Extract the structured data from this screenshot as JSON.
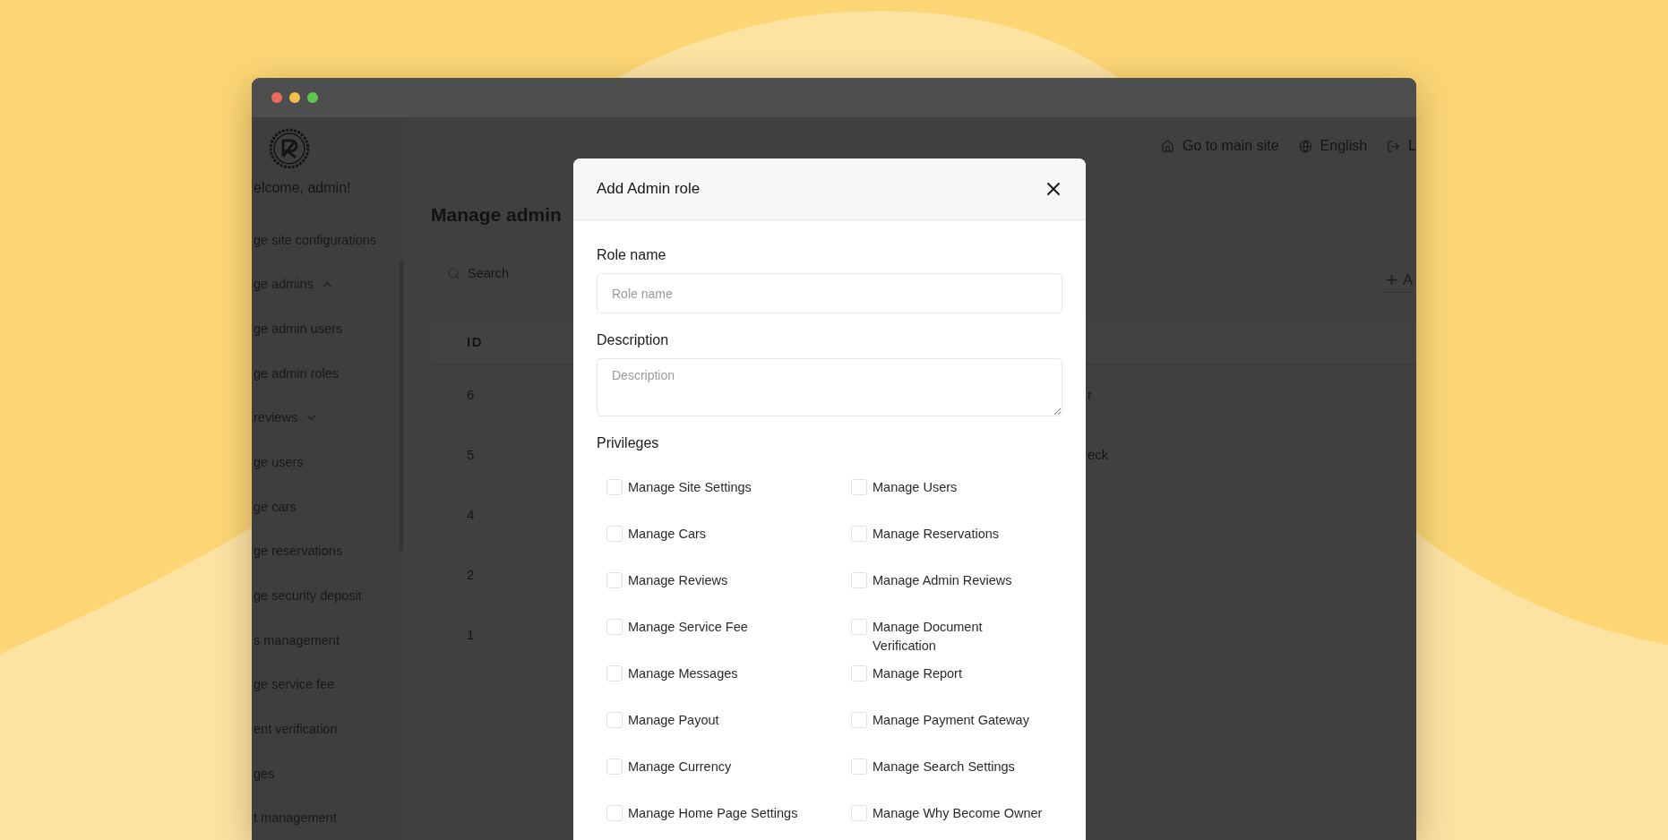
{
  "sidebar": {
    "greeting": "elcome, admin!",
    "items": [
      {
        "label": "ge site configurations"
      },
      {
        "label": "ge admins",
        "expanded": true,
        "children": [
          {
            "label": "ge admin users"
          },
          {
            "label": "ge admin roles"
          }
        ]
      },
      {
        "label": "reviews",
        "expanded": false
      },
      {
        "label": "ge users"
      },
      {
        "label": "ge cars"
      },
      {
        "label": "ge reservations"
      },
      {
        "label": "ge security deposit"
      },
      {
        "label": "s management"
      },
      {
        "label": "ge service fee"
      },
      {
        "label": "ent verification"
      },
      {
        "label": "ges"
      },
      {
        "label": "t management"
      }
    ]
  },
  "header": {
    "links": [
      {
        "kind": "home",
        "label": "Go to main site"
      },
      {
        "kind": "language",
        "label": "English"
      },
      {
        "kind": "logout",
        "label": "L"
      }
    ]
  },
  "page": {
    "title": "Manage admin",
    "search": {
      "placeholder": "Search"
    },
    "add_button": "A",
    "table": {
      "columns": [
        "ID"
      ],
      "rows": [
        {
          "id": "6",
          "column_2": "r"
        },
        {
          "id": "5",
          "column_2": "eck"
        },
        {
          "id": "4"
        },
        {
          "id": "2"
        },
        {
          "id": "1"
        }
      ]
    }
  },
  "modal": {
    "title": "Add Admin role",
    "fields": [
      {
        "kind": "input",
        "label": "Role name",
        "placeholder": "Role name"
      },
      {
        "kind": "textarea",
        "label": "Description",
        "placeholder": "Description"
      }
    ],
    "privileges_label": "Privileges",
    "privileges": [
      {
        "label": "Manage Site Settings",
        "checked": false
      },
      {
        "label": "Manage Users",
        "checked": false
      },
      {
        "label": "Manage Cars",
        "checked": false
      },
      {
        "label": "Manage Reservations",
        "checked": false
      },
      {
        "label": "Manage Reviews",
        "checked": false
      },
      {
        "label": "Manage Admin Reviews",
        "checked": false
      },
      {
        "label": "Manage Service Fee",
        "checked": false
      },
      {
        "label": "Manage Document Verification",
        "checked": false
      },
      {
        "label": "Manage Messages",
        "checked": false
      },
      {
        "label": "Manage Report",
        "checked": false
      },
      {
        "label": "Manage Payout",
        "checked": false
      },
      {
        "label": "Manage Payment Gateway",
        "checked": false
      },
      {
        "label": "Manage Currency",
        "checked": false
      },
      {
        "label": "Manage Search Settings",
        "checked": false
      },
      {
        "label": "Manage Home Page Settings",
        "checked": false
      },
      {
        "label": "Manage Why Become Owner",
        "checked": false
      }
    ]
  }
}
